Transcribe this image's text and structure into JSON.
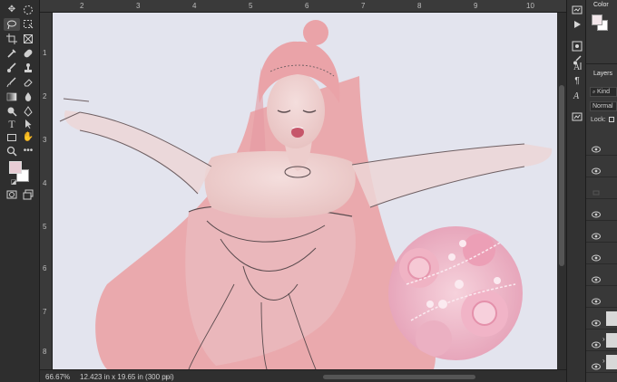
{
  "ruler_top": [
    "2",
    "3",
    "4",
    "5",
    "6",
    "7",
    "8",
    "9",
    "10"
  ],
  "ruler_left": [
    "1",
    "2",
    "3",
    "4",
    "5",
    "6",
    "7",
    "8"
  ],
  "status": {
    "zoom": "66.67%",
    "dimensions": "12.423 in x 19.65 in (300 ppi)",
    "arrow": "›"
  },
  "panels": {
    "color_tab": "Color",
    "layers_tab": "Layers",
    "kind_filter": "Kind",
    "blend_mode": "Normal",
    "lock_label": "Lock:"
  },
  "colors": {
    "foreground": "#e8ccd4",
    "background": "#ffffff",
    "canvas_bg": "#e3e4ee",
    "hair_pink": "#eba8ae"
  },
  "toolbar_icons": [
    "move-icon",
    "marquee-icon",
    "lasso-icon",
    "object-select-icon",
    "crop-icon",
    "frame-icon",
    "eyedropper-icon",
    "healing-icon",
    "brush-icon",
    "stamp-icon",
    "history-brush-icon",
    "eraser-icon",
    "gradient-icon",
    "blur-icon",
    "dodge-icon",
    "pen-icon",
    "type-icon",
    "path-select-icon",
    "rectangle-icon",
    "hand-icon",
    "zoom-icon",
    "more-icon"
  ]
}
